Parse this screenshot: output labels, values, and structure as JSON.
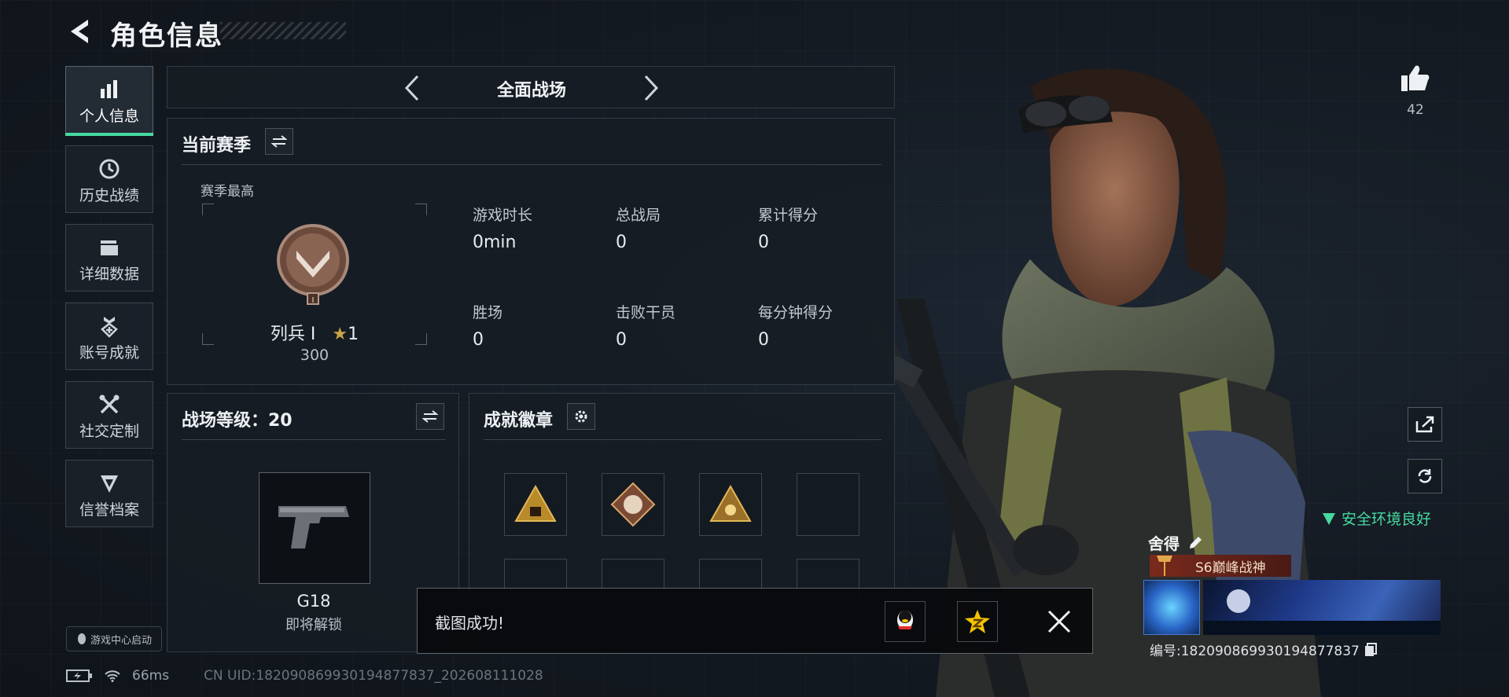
{
  "header": {
    "title": "角色信息"
  },
  "sidebar": {
    "items": [
      {
        "label": "个人信息",
        "icon": "bar-chart-icon"
      },
      {
        "label": "历史战绩",
        "icon": "history-icon"
      },
      {
        "label": "详细数据",
        "icon": "folder-icon"
      },
      {
        "label": "账号成就",
        "icon": "achievement-icon"
      },
      {
        "label": "社交定制",
        "icon": "tools-icon"
      },
      {
        "label": "信誉档案",
        "icon": "shield-icon"
      }
    ],
    "game_center": "游戏中心启动"
  },
  "mode_selector": {
    "label": "全面战场"
  },
  "season": {
    "title": "当前赛季",
    "best_label": "赛季最高",
    "rank_name": "列兵 I",
    "rank_stars": "1",
    "rank_points": "300",
    "stats": [
      {
        "label": "游戏时长",
        "value": "0min"
      },
      {
        "label": "总战局",
        "value": "0"
      },
      {
        "label": "累计得分",
        "value": "0"
      },
      {
        "label": "胜场",
        "value": "0"
      },
      {
        "label": "击败干员",
        "value": "0"
      },
      {
        "label": "每分钟得分",
        "value": "0"
      }
    ]
  },
  "battle_level": {
    "title": "战场等级：20",
    "weapon_name": "G18",
    "weapon_status": "即将解锁"
  },
  "achievements": {
    "title": "成就徽章"
  },
  "likes": {
    "count": "42"
  },
  "security": {
    "text": "安全环境良好"
  },
  "profile": {
    "name": "舍得",
    "title_badge": "S6巅峰战神",
    "id_text": "编号:182090869930194877837"
  },
  "toast": {
    "text": "截图成功!"
  },
  "status_bar": {
    "ping": "66ms",
    "uid": "CN UID:182090869930194877837_202608111028"
  },
  "colors": {
    "accent": "#46d9a0",
    "gold": "#c9a24a",
    "title_red": "#7a2a1c"
  }
}
